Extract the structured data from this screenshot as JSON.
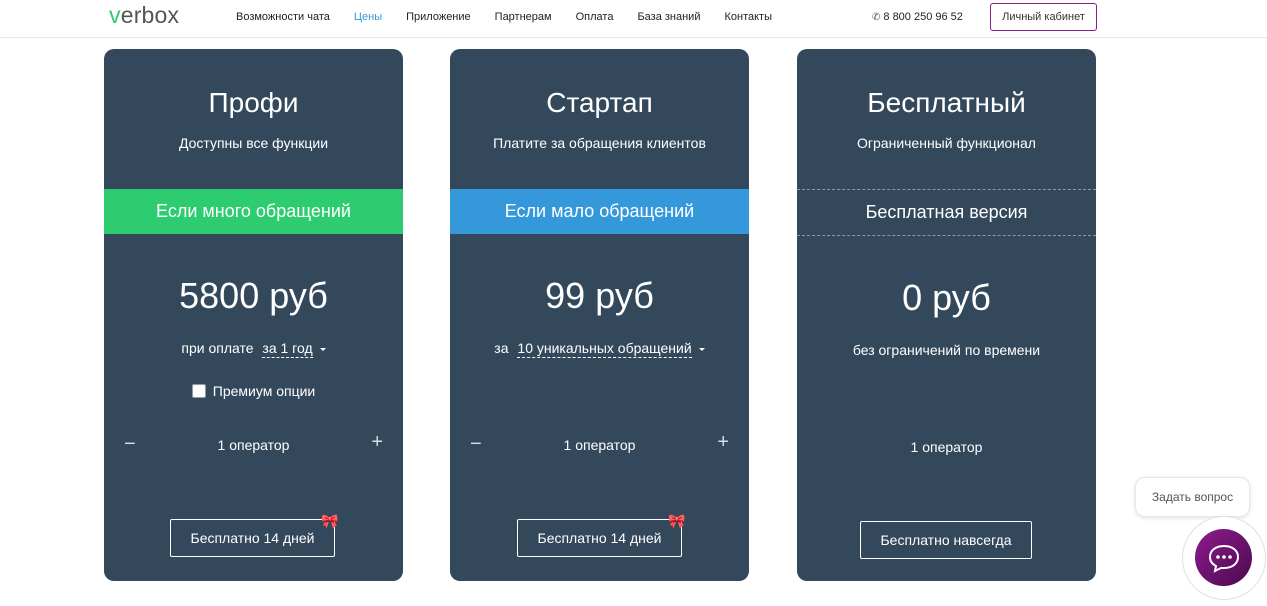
{
  "header": {
    "logo_v": "v",
    "logo_rest": "erbox",
    "nav": [
      {
        "label": "Возможности чата",
        "active": false
      },
      {
        "label": "Цены",
        "active": true
      },
      {
        "label": "Приложение",
        "active": false
      },
      {
        "label": "Партнерам",
        "active": false
      },
      {
        "label": "Оплата",
        "active": false
      },
      {
        "label": "База знаний",
        "active": false
      },
      {
        "label": "Контакты",
        "active": false
      }
    ],
    "phone_icon": "✆",
    "phone": "8 800 250 96 52",
    "cabinet_label": "Личный кабинет"
  },
  "plans": [
    {
      "title": "Профи",
      "subtitle": "Доступны все функции",
      "band": "Если много обращений",
      "band_color": "#2ecc71",
      "price": "5800 руб",
      "period_prefix": "при оплате",
      "period_select": "за 1 год",
      "premium_label": "Премиум опции",
      "premium_checked": false,
      "minus": "−",
      "operators": "1 оператор",
      "plus": "+",
      "cta": "Бесплатно 14 дней",
      "gift_icon": "🎀"
    },
    {
      "title": "Стартап",
      "subtitle": "Платите за обращения клиентов",
      "band": "Если мало обращений",
      "band_color": "#3498db",
      "price": "99 руб",
      "period_prefix": "за",
      "period_select": "10 уникальных обращений",
      "minus": "−",
      "operators": "1 оператор",
      "plus": "+",
      "cta": "Бесплатно 14 дней",
      "gift_icon": "🎀"
    },
    {
      "title": "Бесплатный",
      "subtitle": "Ограниченный функционал",
      "band": "Бесплатная версия",
      "price": "0 руб",
      "period_text": "без ограничений по времени",
      "operators": "1 оператор",
      "cta": "Бесплатно навсегда"
    }
  ],
  "chat": {
    "bubble": "Задать вопрос"
  },
  "colors": {
    "card_bg": "#34485c",
    "accent_purple": "#8e1b8c",
    "nav_active": "#3498db"
  }
}
